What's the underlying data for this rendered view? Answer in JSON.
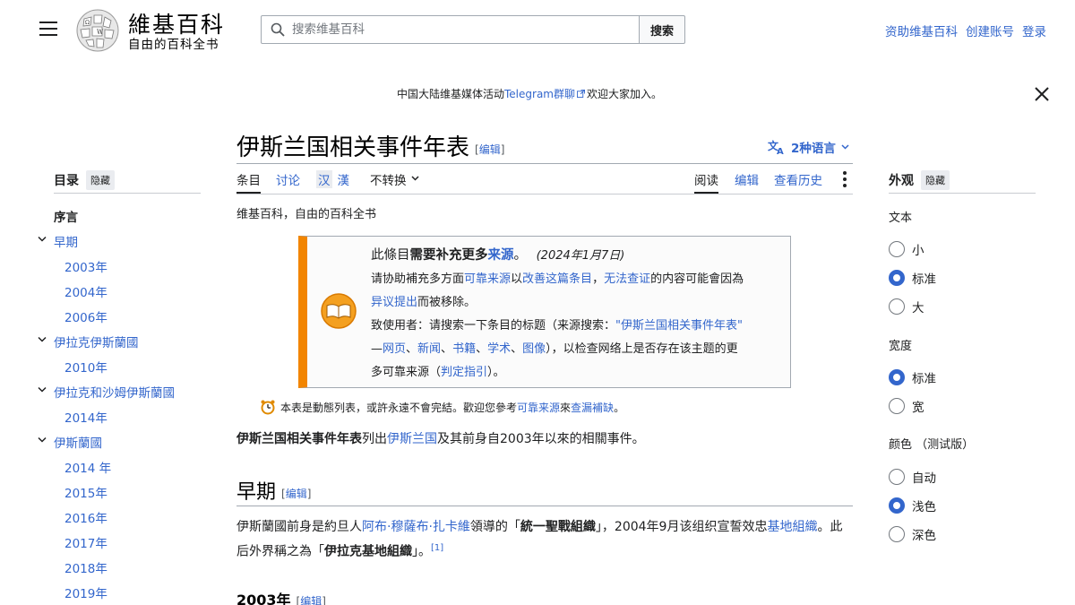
{
  "header": {
    "site_title": "維基百科",
    "tagline": "自由的百科全书",
    "search_placeholder": "搜索维基百科",
    "search_button": "搜索",
    "user_links": [
      "资助维基百科",
      "创建账号",
      "登录"
    ]
  },
  "notice": {
    "pre": "中国大陆维基媒体活动",
    "link": "Telegram群聊",
    "post": "欢迎大家加入。"
  },
  "article": {
    "title": "伊斯兰国相关事件年表",
    "edit_label": "编辑",
    "languages": "2种语言",
    "tabs": {
      "article": "条目",
      "talk": "讨论",
      "variant_a": "汉",
      "variant_b": "漢",
      "no_convert": "不转换",
      "read": "阅读",
      "edit": "编辑",
      "history": "查看历史"
    },
    "from_wiki": "维基百科，自由的百科全书",
    "ambox": {
      "line1_a": "此條目",
      "line1_b": "需要补充更多",
      "line1_c": "来源",
      "line1_d": "。",
      "date": "(2024年1月7日)",
      "l2_a": "请协助補充多方面",
      "l2_b": "可靠来源",
      "l2_c": "以",
      "l2_d": "改善这篇条目",
      "l2_e": "，",
      "l2_f": "无法查证",
      "l2_g": "的内容可能會因為",
      "l3_a": "异议提出",
      "l3_b": "而被移除。",
      "l4_a": "致使用者：请搜索一下条目的标题（来源搜索：",
      "l4_b": "\"伊斯兰国相关事件年表\"",
      "l5_a": "—",
      "l5_b": "网页",
      "l5_c": "、",
      "l5_d": "新闻",
      "l5_e": "、",
      "l5_f": "书籍",
      "l5_g": "、",
      "l5_h": "学术",
      "l5_i": "、",
      "l5_j": "图像",
      "l5_k": "），以检查网络上是否存在该主题的更",
      "l6_a": "多可靠来源（",
      "l6_b": "判定指引",
      "l6_c": "）。"
    },
    "dynamic_note": {
      "pre": "本表是動態列表，或許永遠不會完結。歡迎您參考",
      "link1": "可靠来源",
      "mid": "來",
      "link2": "查漏補缺",
      "post": "。"
    },
    "intro": {
      "bold": "伊斯兰国相关事件年表",
      "a": "列出",
      "link": "伊斯兰国",
      "b": "及其前身自2003年以來的相關事件。"
    },
    "section1": {
      "heading": "早期",
      "p_a": "伊斯蘭國前身是約旦人",
      "p_link1": "阿布·穆薩布·扎卡維",
      "p_b": "領導的「",
      "p_bold1": "統一聖戰組織",
      "p_c": "」，2004年9月该组织宣誓效忠",
      "p_link2": "基地組織",
      "p_d": "。此后外界稱之為「",
      "p_bold2": "伊拉克基地組織",
      "p_e": "」。",
      "ref": "[1]"
    },
    "section2_heading": "2003年"
  },
  "toc": {
    "title": "目录",
    "hide": "隐藏",
    "items": [
      {
        "label": "序言",
        "level": "top"
      },
      {
        "label": "早期",
        "level": "l1",
        "chevron": true
      },
      {
        "label": "2003年",
        "level": "l2"
      },
      {
        "label": "2004年",
        "level": "l2"
      },
      {
        "label": "2006年",
        "level": "l2"
      },
      {
        "label": "伊拉克伊斯蘭國",
        "level": "l1",
        "chevron": true
      },
      {
        "label": "2010年",
        "level": "l2"
      },
      {
        "label": "伊拉克和沙姆伊斯蘭國",
        "level": "l1",
        "chevron": true
      },
      {
        "label": "2014年",
        "level": "l2"
      },
      {
        "label": "伊斯蘭國",
        "level": "l1",
        "chevron": true
      },
      {
        "label": "2014 年",
        "level": "l2"
      },
      {
        "label": "2015年",
        "level": "l2"
      },
      {
        "label": "2016年",
        "level": "l2"
      },
      {
        "label": "2017年",
        "level": "l2"
      },
      {
        "label": "2018年",
        "level": "l2"
      },
      {
        "label": "2019年",
        "level": "l2"
      }
    ]
  },
  "appearance": {
    "title": "外观",
    "hide": "隐藏",
    "text_label": "文本",
    "text_options": [
      "小",
      "标准",
      "大"
    ],
    "text_selected": 1,
    "width_label": "宽度",
    "width_options": [
      "标准",
      "宽"
    ],
    "width_selected": 0,
    "color_label": "颜色 （测试版）",
    "color_options": [
      "自动",
      "浅色",
      "深色"
    ],
    "color_selected": 1
  },
  "colors": {
    "link": "#3366cc",
    "ambox_accent": "#f28500"
  }
}
